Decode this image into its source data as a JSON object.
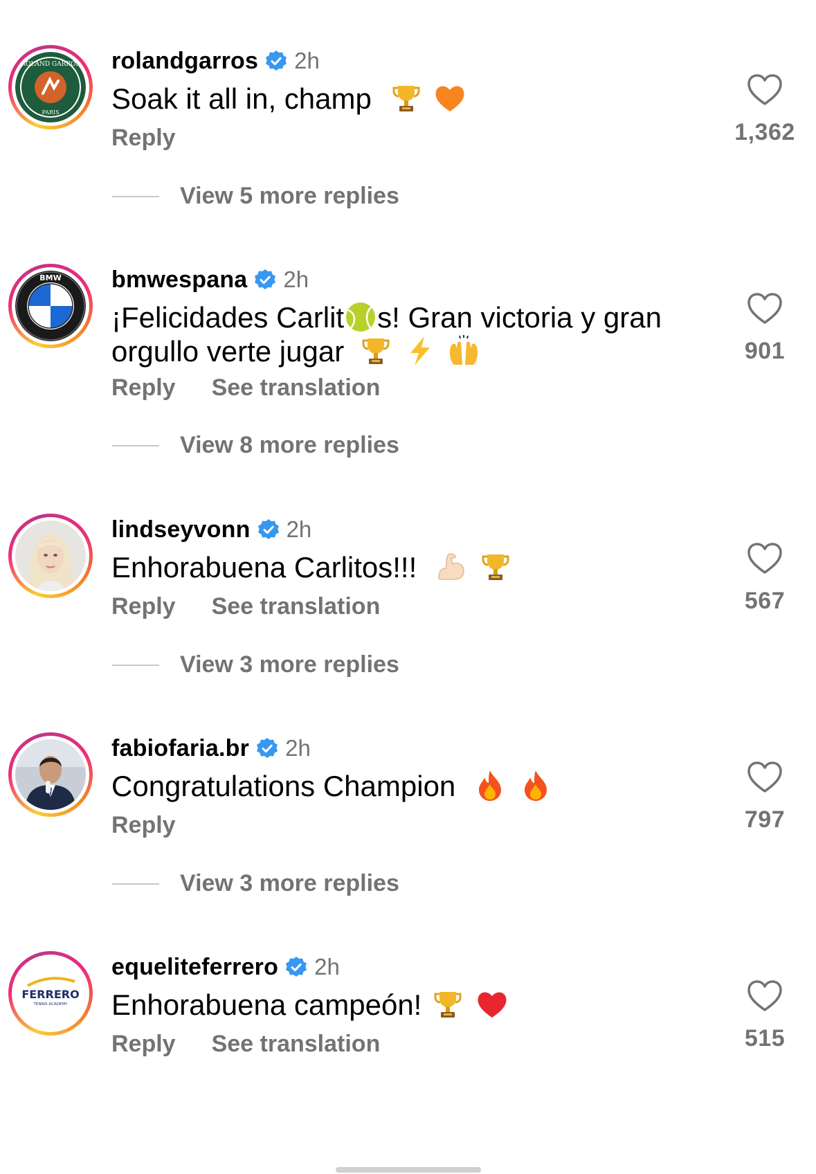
{
  "comments": [
    {
      "username": "rolandgarros",
      "time": "2h",
      "text": "Soak it all in, champ",
      "emojis": [
        "trophy-emoji",
        "orange-heart-emoji"
      ],
      "reply": "Reply",
      "likes": "1,362",
      "view_replies": "View 5 more replies",
      "avatar": "roland-garros-logo",
      "avatar_text_top": "ROLAND GARROS",
      "avatar_text_bottom": "PARIS"
    },
    {
      "username": "bmwespana",
      "time": "2h",
      "text_part1": "¡Felicidades Carlit",
      "text_part2": "s! Gran victoria y gran orgullo verte jugar",
      "emojis": [
        "tennis-ball-emoji",
        "trophy-emoji",
        "lightning-emoji",
        "raising-hands-emoji"
      ],
      "reply": "Reply",
      "translate": "See translation",
      "likes": "901",
      "view_replies": "View 8 more replies",
      "avatar": "bmw-logo",
      "avatar_text": "BMW"
    },
    {
      "username": "lindseyvonn",
      "time": "2h",
      "text": "Enhorabuena Carlitos!!!",
      "emojis": [
        "flexed-biceps-emoji",
        "trophy-emoji"
      ],
      "reply": "Reply",
      "translate": "See translation",
      "likes": "567",
      "view_replies": "View 3 more replies",
      "avatar": "profile-photo"
    },
    {
      "username": "fabiofaria.br",
      "time": "2h",
      "text": "Congratulations Champion",
      "emojis": [
        "fire-emoji",
        "fire-emoji"
      ],
      "reply": "Reply",
      "likes": "797",
      "view_replies": "View 3 more replies",
      "avatar": "profile-photo"
    },
    {
      "username": "equeliteferrero",
      "time": "2h",
      "text": "Enhorabuena campeón!",
      "emojis": [
        "trophy-emoji",
        "red-heart-emoji"
      ],
      "reply": "Reply",
      "translate": "See translation",
      "likes": "515",
      "avatar": "ferrero-logo",
      "avatar_text": "FERRERO",
      "avatar_subtext": "TENNIS ACADEMY"
    }
  ],
  "colors": {
    "secondary_text": "#737373",
    "verified_blue": "#3897f0",
    "roland_garros_green": "#1d5c3c",
    "roland_garros_orange": "#d2632b",
    "ferrero_navy": "#1e2f6b"
  }
}
